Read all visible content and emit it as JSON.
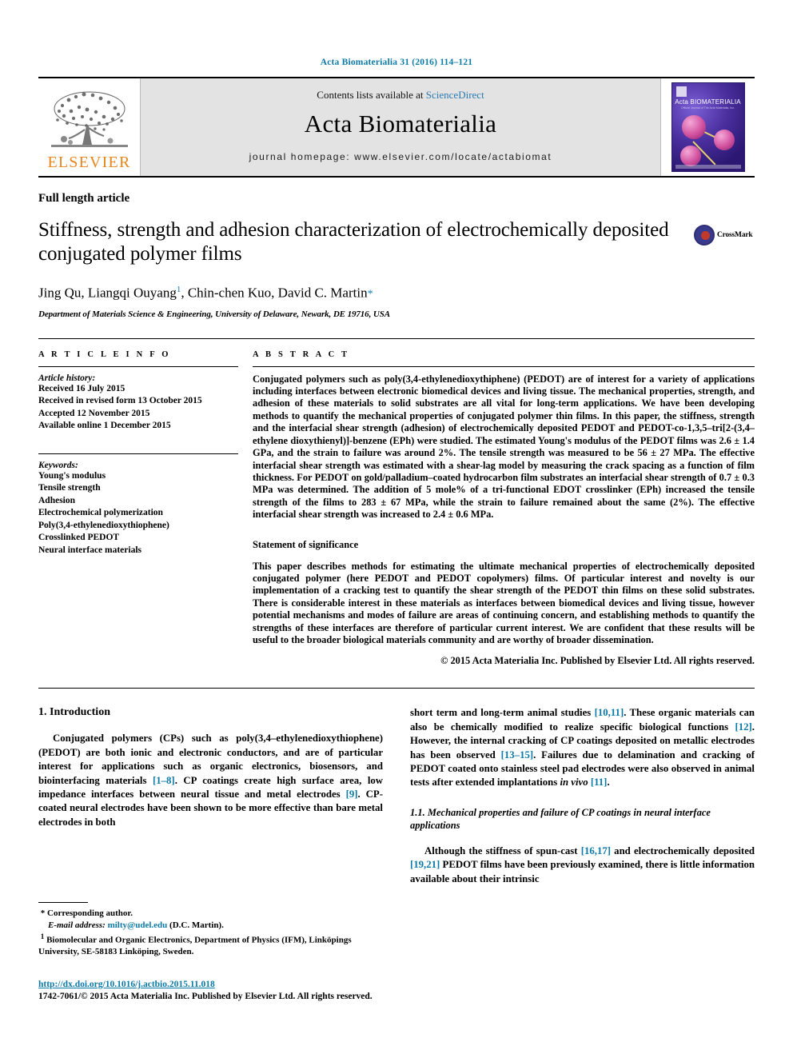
{
  "running_head": "Acta Biomaterialia 31 (2016) 114–121",
  "masthead": {
    "publisher_logo_text": "ELSEVIER",
    "contents_prefix": "Contents lists available at ",
    "contents_link": "ScienceDirect",
    "journal_title": "Acta Biomaterialia",
    "homepage": "journal homepage: www.elsevier.com/locate/actabiomat",
    "cover": {
      "title": "Acta BIOMATERIALIA",
      "subtitle": "Official Journal of The Acta Materialia, Inc."
    }
  },
  "article": {
    "type": "Full length article",
    "title": "Stiffness, strength and adhesion characterization of electrochemically deposited conjugated polymer films",
    "authors": "Jing Qu, Liangqi Ouyang",
    "authors_sup": "1",
    "authors_rest": ", Chin-chen Kuo, David C. Martin",
    "corresponding_mark": "*",
    "affiliation": "Department of Materials Science & Engineering, University of Delaware, Newark, DE 19716, USA",
    "crossmark_label": "CrossMark"
  },
  "info": {
    "heading": "A R T I C L E   I N F O",
    "history_label": "Article history:",
    "history": [
      "Received 16 July 2015",
      "Received in revised form 13 October 2015",
      "Accepted 12 November 2015",
      "Available online 1 December 2015"
    ],
    "keywords_label": "Keywords:",
    "keywords": [
      "Young's modulus",
      "Tensile strength",
      "Adhesion",
      "Electrochemical polymerization",
      "Poly(3,4-ethylenedioxythiophene)",
      "Crosslinked PEDOT",
      "Neural interface materials"
    ]
  },
  "abstract": {
    "heading": "A B S T R A C T",
    "text": "Conjugated polymers such as poly(3,4-ethylenedioxythiphene) (PEDOT) are of interest for a variety of applications including interfaces between electronic biomedical devices and living tissue. The mechanical properties, strength, and adhesion of these materials to solid substrates are all vital for long-term applications. We have been developing methods to quantify the mechanical properties of conjugated polymer thin films. In this paper, the stiffness, strength and the interfacial shear strength (adhesion) of electrochemically deposited PEDOT and PEDOT-co-1,3,5–tri[2-(3,4–ethylene dioxythienyl)]-benzene (EPh) were studied. The estimated Young's modulus of the PEDOT films was 2.6 ± 1.4 GPa, and the strain to failure was around 2%. The tensile strength was measured to be 56 ± 27 MPa. The effective interfacial shear strength was estimated with a shear-lag model by measuring the crack spacing as a function of film thickness. For PEDOT on gold/palladium–coated hydrocarbon film substrates an interfacial shear strength of 0.7 ± 0.3 MPa was determined. The addition of 5 mole% of a tri-functional EDOT crosslinker (EPh) increased the tensile strength of the films to 283 ± 67 MPa, while the strain to failure remained about the same (2%). The effective interfacial shear strength was increased to 2.4 ± 0.6 MPa.",
    "significance_heading": "Statement of significance",
    "significance_text": "This paper describes methods for estimating the ultimate mechanical properties of electrochemically deposited conjugated polymer (here PEDOT and PEDOT copolymers) films. Of particular interest and novelty is our implementation of a cracking test to quantify the shear strength of the PEDOT thin films on these solid substrates. There is considerable interest in these materials as interfaces between biomedical devices and living tissue, however potential mechanisms and modes of failure are areas of continuing concern, and establishing methods to quantify the strengths of these interfaces are therefore of particular current interest. We are confident that these results will be useful to the broader biological materials community and are worthy of broader dissemination.",
    "copyright": "© 2015 Acta Materialia Inc. Published by Elsevier Ltd. All rights reserved."
  },
  "body": {
    "section1_title": "1. Introduction",
    "left_para1_a": "Conjugated polymers (CPs) such as poly(3,4–ethylenedioxythiophene) (PEDOT) are both ionic and electronic conductors, and are of particular interest for applications such as organic electronics, biosensors, and biointerfacing materials ",
    "left_ref1": "[1–8]",
    "left_para1_b": ". CP coatings create high surface area, low impedance interfaces between neural tissue and metal electrodes ",
    "left_ref2": "[9]",
    "left_para1_c": ". CP-coated neural electrodes have been shown to be more effective than bare metal electrodes in both",
    "right_para1_a": "short term and long-term animal studies ",
    "right_ref1": "[10,11]",
    "right_para1_b": ". These organic materials can also be chemically modified to realize specific biological functions ",
    "right_ref2": "[12]",
    "right_para1_c": ". However, the internal cracking of CP coatings deposited on metallic electrodes has been observed ",
    "right_ref3": "[13–15]",
    "right_para1_d": ". Failures due to delamination and cracking of PEDOT coated onto stainless steel pad electrodes were also observed in animal tests after extended implantations ",
    "right_invivo": "in vivo",
    "right_ref4": "[11]",
    "right_para1_e": ".",
    "subsection_title": "1.1. Mechanical properties and failure of CP coatings in neural interface applications",
    "right_para2_a": "Although the stiffness of spun-cast ",
    "right_ref5": "[16,17]",
    "right_para2_b": " and electrochemically deposited ",
    "right_ref6": "[19,21]",
    "right_para2_c": " PEDOT films have been previously examined, there is little information available about their intrinsic"
  },
  "footnotes": {
    "corresponding": "Corresponding author.",
    "corresponding_mark": "*",
    "email_label": "E-mail address:",
    "email": "milty@udel.edu",
    "email_suffix": "(D.C. Martin).",
    "note1_mark": "1",
    "note1": "Biomolecular and Organic Electronics, Department of Physics (IFM), Linköpings University, SE-58183 Linköping, Sweden."
  },
  "doi_block": {
    "doi": "http://dx.doi.org/10.1016/j.actbio.2015.11.018",
    "issn": "1742-7061/© 2015 Acta Materialia Inc. Published by Elsevier Ltd. All rights reserved."
  },
  "colors": {
    "link_blue": "#0b7aa8",
    "elsevier_orange": "#E8861E",
    "masthead_gray": "#e3e3e3"
  }
}
